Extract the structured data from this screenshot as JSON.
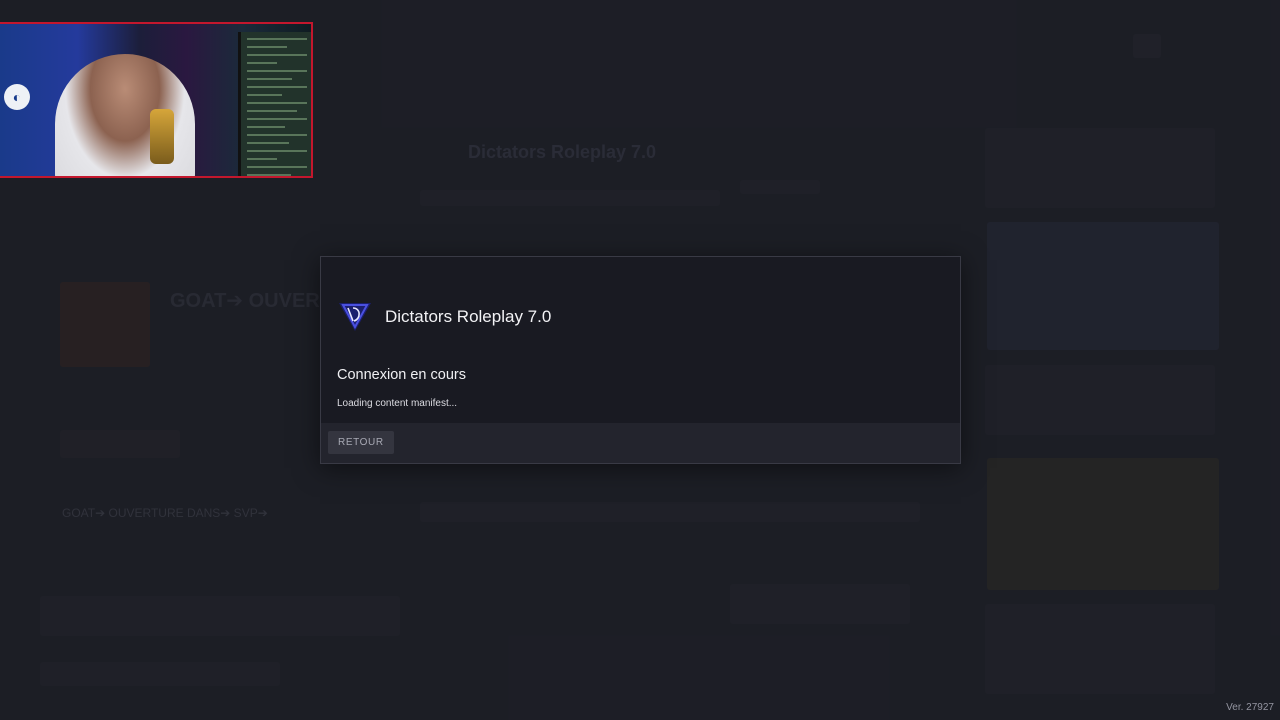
{
  "dialog": {
    "server_name": "Dictators Roleplay 7.0",
    "status_title": "Connexion en cours",
    "status_detail": "Loading content manifest...",
    "back_button": "RETOUR",
    "accent_color": "#3a3fd0"
  },
  "footer": {
    "version": "Ver. 27927"
  },
  "background": {
    "server_header": "Dictators Roleplay 7.0",
    "banner_text": "GOAT➔ OUVERT",
    "section_text": "GOAT➔ OUVERTURE DANS➔ SVP➔"
  },
  "webcam": {
    "present": true,
    "border_color": "#c3172d"
  }
}
